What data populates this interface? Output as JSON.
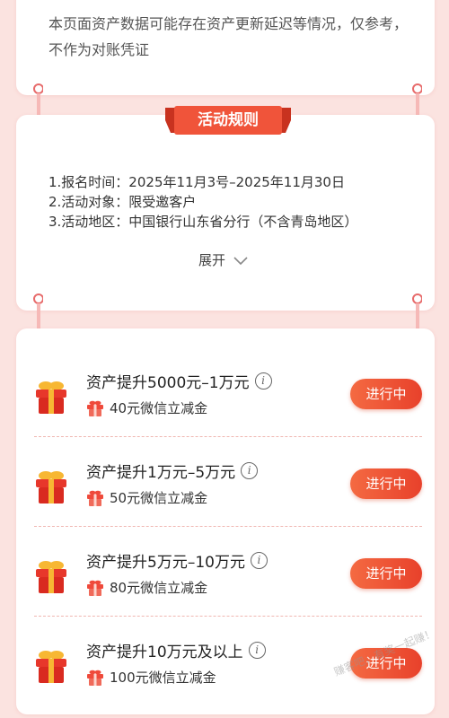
{
  "notice": {
    "text": "本页面资产数据可能存在资产更新延迟等情况，仅参考，不作为对账凭证"
  },
  "rules": {
    "title": "活动规则",
    "items": [
      "1.报名时间：2025年11月3号–2025年11月30日",
      "2.活动对象：限受邀客户",
      "3.活动地区：中国银行山东省分行（不含青岛地区）"
    ],
    "expand_label": "展开"
  },
  "activities": [
    {
      "title": "资产提升5000元–1万元",
      "reward": "40元微信立减金",
      "status": "进行中"
    },
    {
      "title": "资产提升1万元–5万元",
      "reward": "50元微信立减金",
      "status": "进行中"
    },
    {
      "title": "资产提升5万元–10万元",
      "reward": "80元微信立减金",
      "status": "进行中"
    },
    {
      "title": "资产提升10万元及以上",
      "reward": "100元微信立减金",
      "status": "进行中"
    }
  ],
  "info_glyph": "i",
  "watermark": "赚客吧，有奖一起赚！",
  "colors": {
    "accent": "#e8412b",
    "background": "#fbe3e0",
    "ribbon": "#f0543a"
  }
}
